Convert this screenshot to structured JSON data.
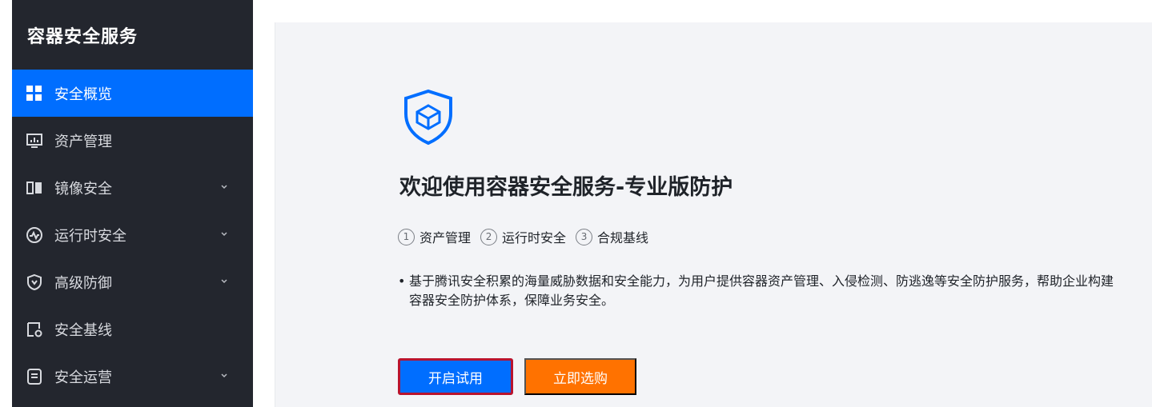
{
  "sidebar": {
    "title": "容器安全服务",
    "items": [
      {
        "label": "安全概览",
        "icon": "dashboard-icon",
        "active": true,
        "expandable": false
      },
      {
        "label": "资产管理",
        "icon": "monitor-icon",
        "active": false,
        "expandable": false
      },
      {
        "label": "镜像安全",
        "icon": "image-layers-icon",
        "active": false,
        "expandable": true
      },
      {
        "label": "运行时安全",
        "icon": "pulse-circle-icon",
        "active": false,
        "expandable": true
      },
      {
        "label": "高级防御",
        "icon": "shield-icon",
        "active": false,
        "expandable": true
      },
      {
        "label": "安全基线",
        "icon": "baseline-check-icon",
        "active": false,
        "expandable": false
      },
      {
        "label": "安全运营",
        "icon": "document-list-icon",
        "active": false,
        "expandable": true
      }
    ]
  },
  "main": {
    "icon": "container-shield-icon",
    "title": "欢迎使用容器安全服务-专业版防护",
    "steps": [
      {
        "number": "1",
        "label": "资产管理"
      },
      {
        "number": "2",
        "label": "运行时安全"
      },
      {
        "number": "3",
        "label": "合规基线"
      }
    ],
    "description": "基于腾讯安全积累的海量威胁数据和安全能力，为用户提供容器资产管理、入侵检测、防逃逸等安全防护服务，帮助企业构建容器安全防护体系，保障业务安全。",
    "buttons": {
      "trial": "开启试用",
      "buy": "立即选购"
    }
  },
  "colors": {
    "sidebar_bg": "#23262e",
    "active_blue": "#006eff",
    "buy_orange": "#ff7200",
    "highlight_red": "#b8142f",
    "panel_bg": "#f3f4f7"
  }
}
